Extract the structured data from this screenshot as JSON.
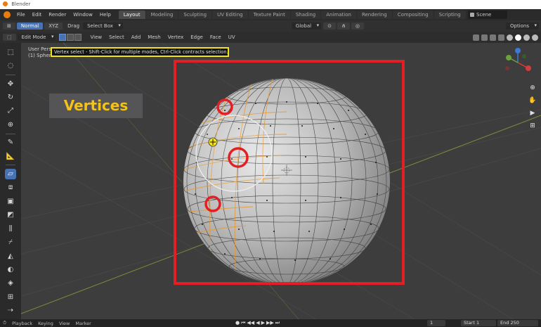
{
  "window": {
    "title": "Blender"
  },
  "menubar": {
    "menus": [
      "File",
      "Edit",
      "Render",
      "Window",
      "Help"
    ],
    "workspaces": [
      "Layout",
      "Modeling",
      "Sculpting",
      "UV Editing",
      "Texture Paint",
      "Shading",
      "Animation",
      "Rendering",
      "Compositing",
      "Scripting"
    ],
    "active_workspace": "Layout",
    "scene": "Scene"
  },
  "toolbar1": {
    "normal_label": "Normal",
    "xyz_label": "XYZ",
    "drag_label": "Drag",
    "select_box_label": "Select Box",
    "transform_label": "Global",
    "options_label": "Options"
  },
  "toolbar2": {
    "view_mode": "Edit Mode",
    "menus": [
      "View",
      "Select",
      "Add",
      "Mesh",
      "Vertex",
      "Edge",
      "Face",
      "UV"
    ]
  },
  "viewport": {
    "overlay_line1": "User Persp",
    "overlay_line2": "(1) Sphere",
    "tooltip": "Vertex select - Shift-Click for multiple modes, Ctrl-Click contracts selection.",
    "annotation": "Vertices",
    "gizmo_axes": [
      "X",
      "Y",
      "Z"
    ]
  },
  "tools": [
    "select",
    "cursor",
    "move",
    "rotate",
    "scale",
    "transform",
    "annotate",
    "measure",
    "add-cube",
    "extrude",
    "inset",
    "bevel",
    "loop-cut",
    "knife",
    "poly-build",
    "spin",
    "smooth",
    "edge-slide",
    "shrink",
    "shear",
    "rip"
  ],
  "statusbar": {
    "items": [
      "Playback",
      "Keying",
      "View",
      "Marker"
    ],
    "current_frame": "1",
    "start_label": "Start",
    "start_value": "1",
    "end_label": "End",
    "end_value": "250"
  },
  "colors": {
    "accent": "#4772b3",
    "annotation_red": "#e31e24",
    "tooltip_border": "#f1e21a",
    "vertices_text": "#f3c21b",
    "selection_orange": "#e8972e"
  }
}
